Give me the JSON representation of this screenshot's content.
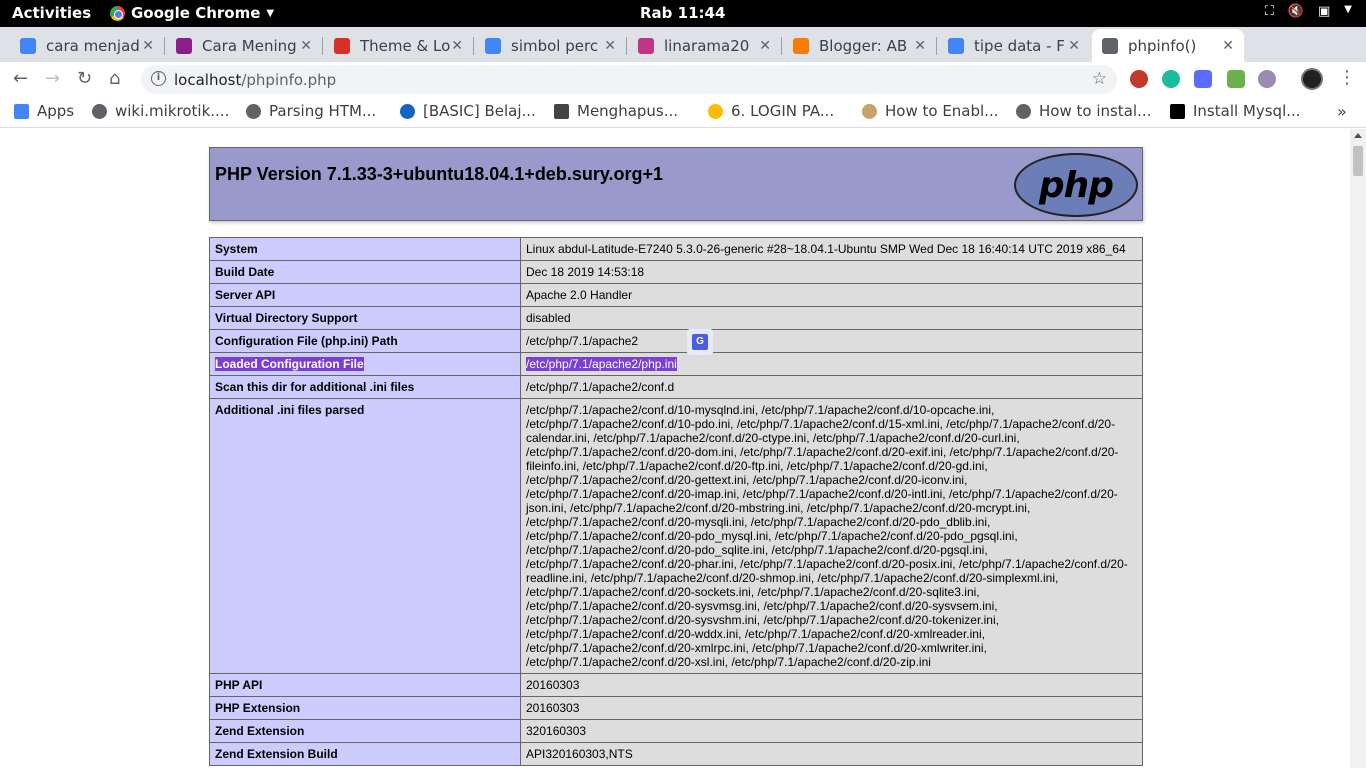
{
  "system_bar": {
    "activities": "Activities",
    "app_name": "Google Chrome",
    "clock": "Rab 11:44"
  },
  "tabs": [
    {
      "title": "cara menjad",
      "favicon": "google-icon",
      "color": "#4285f4"
    },
    {
      "title": "Cara Mening",
      "favicon": "h-icon",
      "color": "#8b1e8b"
    },
    {
      "title": "Theme & Lo",
      "favicon": "notification-icon",
      "color": "#d93025"
    },
    {
      "title": "simbol perc",
      "favicon": "google-icon",
      "color": "#4285f4"
    },
    {
      "title": "linarama20",
      "favicon": "instagram-icon",
      "color": "#c13584"
    },
    {
      "title": "Blogger: AB",
      "favicon": "blogger-icon",
      "color": "#f57d00"
    },
    {
      "title": "tipe data - F",
      "favicon": "google-icon",
      "color": "#4285f4"
    },
    {
      "title": "phpinfo()",
      "favicon": "globe-icon",
      "color": "#5f6368"
    }
  ],
  "address_bar": {
    "host": "localhost",
    "path": "/phpinfo.php"
  },
  "bookmarks": [
    {
      "label": "Apps",
      "icon": "apps-grid-icon"
    },
    {
      "label": "wiki.mikrotik....",
      "icon": "globe-icon"
    },
    {
      "label": "Parsing HTM...",
      "icon": "globe-icon"
    },
    {
      "label": "[BASIC] Belaj...",
      "icon": "blue-dot-icon"
    },
    {
      "label": "Menghapus...",
      "icon": "terminal-icon"
    },
    {
      "label": "6. LOGIN PA...",
      "icon": "drive-icon"
    },
    {
      "label": "How to Enabl...",
      "icon": "avatar-icon"
    },
    {
      "label": "How to instal...",
      "icon": "globe-icon"
    },
    {
      "label": "Install Mysql...",
      "icon": "medium-icon"
    }
  ],
  "phpinfo": {
    "title": "PHP Version 7.1.33-3+ubuntu18.04.1+deb.sury.org+1",
    "logo_text": "php",
    "rows": [
      {
        "key": "System",
        "value": "Linux abdul-Latitude-E7240 5.3.0-26-generic #28~18.04.1-Ubuntu SMP Wed Dec 18 16:40:14 UTC 2019 x86_64"
      },
      {
        "key": "Build Date",
        "value": "Dec 18 2019 14:53:18"
      },
      {
        "key": "Server API",
        "value": "Apache 2.0 Handler"
      },
      {
        "key": "Virtual Directory Support",
        "value": "disabled"
      },
      {
        "key": "Configuration File (php.ini) Path",
        "value": "/etc/php/7.1/apache2"
      },
      {
        "key": "Loaded Configuration File",
        "value": "/etc/php/7.1/apache2/php.ini"
      },
      {
        "key": "Scan this dir for additional .ini files",
        "value": "/etc/php/7.1/apache2/conf.d"
      },
      {
        "key": "Additional .ini files parsed",
        "value": "/etc/php/7.1/apache2/conf.d/10-mysqlnd.ini, /etc/php/7.1/apache2/conf.d/10-opcache.ini, /etc/php/7.1/apache2/conf.d/10-pdo.ini, /etc/php/7.1/apache2/conf.d/15-xml.ini, /etc/php/7.1/apache2/conf.d/20-calendar.ini, /etc/php/7.1/apache2/conf.d/20-ctype.ini, /etc/php/7.1/apache2/conf.d/20-curl.ini, /etc/php/7.1/apache2/conf.d/20-dom.ini, /etc/php/7.1/apache2/conf.d/20-exif.ini, /etc/php/7.1/apache2/conf.d/20-fileinfo.ini, /etc/php/7.1/apache2/conf.d/20-ftp.ini, /etc/php/7.1/apache2/conf.d/20-gd.ini, /etc/php/7.1/apache2/conf.d/20-gettext.ini, /etc/php/7.1/apache2/conf.d/20-iconv.ini, /etc/php/7.1/apache2/conf.d/20-imap.ini, /etc/php/7.1/apache2/conf.d/20-intl.ini, /etc/php/7.1/apache2/conf.d/20-json.ini, /etc/php/7.1/apache2/conf.d/20-mbstring.ini, /etc/php/7.1/apache2/conf.d/20-mcrypt.ini, /etc/php/7.1/apache2/conf.d/20-mysqli.ini, /etc/php/7.1/apache2/conf.d/20-pdo_dblib.ini, /etc/php/7.1/apache2/conf.d/20-pdo_mysql.ini, /etc/php/7.1/apache2/conf.d/20-pdo_pgsql.ini, /etc/php/7.1/apache2/conf.d/20-pdo_sqlite.ini, /etc/php/7.1/apache2/conf.d/20-pgsql.ini, /etc/php/7.1/apache2/conf.d/20-phar.ini, /etc/php/7.1/apache2/conf.d/20-posix.ini, /etc/php/7.1/apache2/conf.d/20-readline.ini, /etc/php/7.1/apache2/conf.d/20-shmop.ini, /etc/php/7.1/apache2/conf.d/20-simplexml.ini, /etc/php/7.1/apache2/conf.d/20-sockets.ini, /etc/php/7.1/apache2/conf.d/20-sqlite3.ini, /etc/php/7.1/apache2/conf.d/20-sysvmsg.ini, /etc/php/7.1/apache2/conf.d/20-sysvsem.ini, /etc/php/7.1/apache2/conf.d/20-sysvshm.ini, /etc/php/7.1/apache2/conf.d/20-tokenizer.ini, /etc/php/7.1/apache2/conf.d/20-wddx.ini, /etc/php/7.1/apache2/conf.d/20-xmlreader.ini, /etc/php/7.1/apache2/conf.d/20-xmlrpc.ini, /etc/php/7.1/apache2/conf.d/20-xmlwriter.ini, /etc/php/7.1/apache2/conf.d/20-xsl.ini, /etc/php/7.1/apache2/conf.d/20-zip.ini"
      },
      {
        "key": "PHP API",
        "value": "20160303"
      },
      {
        "key": "PHP Extension",
        "value": "20160303"
      },
      {
        "key": "Zend Extension",
        "value": "320160303"
      },
      {
        "key": "Zend Extension Build",
        "value": "API320160303,NTS"
      }
    ]
  },
  "colors": {
    "header_bg": "#9999cc",
    "key_cell_bg": "#ccccff",
    "value_cell_bg": "#dddddd",
    "selection": "#7a3fd4"
  }
}
